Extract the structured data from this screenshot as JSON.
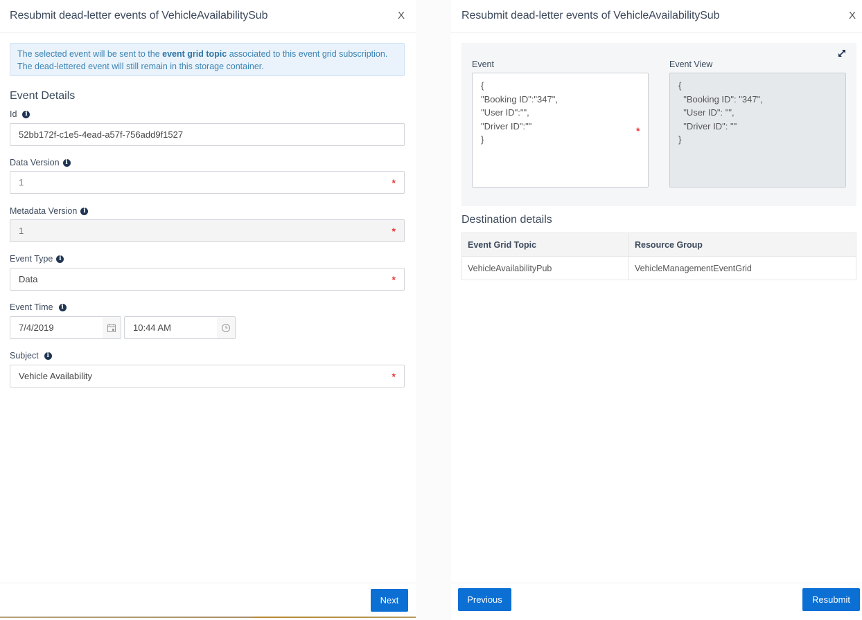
{
  "left_panel": {
    "title": "Resubmit dead-letter events of VehicleAvailabilitySub",
    "close_label": "X",
    "info": {
      "prefix": "The selected event will be sent to the ",
      "bold": "event grid topic",
      "suffix": " associated to this event grid subscription. The dead-lettered event will still remain in this storage container."
    },
    "section_title": "Event Details",
    "fields": {
      "id": {
        "label": "Id",
        "value": "52bb172f-c1e5-4ead-a57f-756add9f1527"
      },
      "data_version": {
        "label": "Data Version",
        "value": "1",
        "required": "*"
      },
      "metadata_version": {
        "label": "Metadata Version",
        "value": "1",
        "required": "*"
      },
      "event_type": {
        "label": "Event Type",
        "value": "Data",
        "required": "*"
      },
      "event_time": {
        "label": "Event Time",
        "date": "7/4/2019",
        "time": "10:44 AM"
      },
      "subject": {
        "label": "Subject",
        "value": "Vehicle Availability",
        "required": "*"
      }
    },
    "info_icon_glyph": "i",
    "next_label": "Next"
  },
  "right_panel": {
    "title": "Resubmit dead-letter events of VehicleAvailabilitySub",
    "close_label": "X",
    "event_label": "Event",
    "event_text": "{\n\"Booking ID\":\"347\",\n\"User ID\":\"\",\n\"Driver ID\":\"\"\n}",
    "event_required": "*",
    "event_view_label": "Event View",
    "event_view_text": "{\n  \"Booking ID\": \"347\",\n  \"User ID\": \"\",\n  \"Driver ID\": \"\"\n}",
    "destination_title": "Destination details",
    "table": {
      "headers": [
        "Event Grid Topic",
        "Resource Group"
      ],
      "rows": [
        [
          "VehicleAvailabilityPub",
          "VehicleManagementEventGrid"
        ]
      ]
    },
    "previous_label": "Previous",
    "resubmit_label": "Resubmit"
  }
}
